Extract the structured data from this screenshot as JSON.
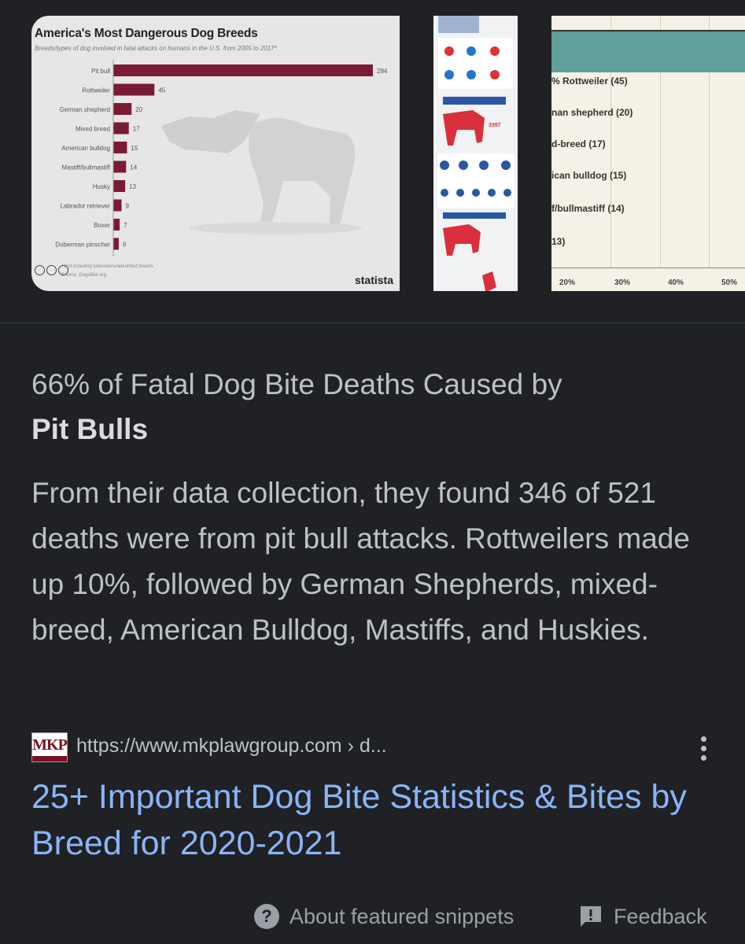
{
  "images": {
    "chart_title": "America's Most Dangerous Dog Breeds",
    "chart_subtitle": "Breeds/types of dog involved in fatal attacks on humans in the U.S. from 2005 to 2017*",
    "chart_footnote": "* Not including unknown/unidentified breeds",
    "chart_source": "Source: DogsBite.org",
    "chart_brand": "statista",
    "infographic_number": "3397",
    "third_rows": [
      "% Rottweiler (45)",
      "nan shepherd (20)",
      "d-breed (17)",
      "ican bulldog (15)",
      "f/bullmastiff (14)",
      "13)"
    ],
    "third_ticks": [
      "20%",
      "30%",
      "40%",
      "50%"
    ]
  },
  "chart_data": {
    "type": "bar",
    "title": "America's Most Dangerous Dog Breeds",
    "subtitle": "Breeds/types of dog involved in fatal attacks on humans in the U.S. from 2005 to 2017*",
    "categories": [
      "Pit bull",
      "Rottweiler",
      "German shepherd",
      "Mixed breed",
      "American bulldog",
      "Mastiff/bullmastiff",
      "Husky",
      "Labrador retriever",
      "Boxer",
      "Doberman pinscher"
    ],
    "values": [
      284,
      45,
      20,
      17,
      15,
      14,
      13,
      9,
      7,
      6
    ],
    "xlim": [
      0,
      300
    ],
    "orientation": "horizontal",
    "bar_color": "#7b1a35"
  },
  "snippet": {
    "headline_plain": "66% of Fatal Dog Bite Deaths Caused by",
    "headline_bold": "Pit Bulls",
    "text": "From their data collection, they found 346 of 521 deaths were from pit bull attacks. Rottweilers made up 10%, followed by German Shepherds, mixed-breed, American Bulldog, Mastiffs, and Huskies."
  },
  "source": {
    "favicon_text": "MKP",
    "url": "https://www.mkplawgroup.com › d...",
    "title": "25+ Important Dog Bite Statistics & Bites by Breed for 2020-2021"
  },
  "footer": {
    "about_icon": "?",
    "about_label": "About featured snippets",
    "feedback_label": "Feedback"
  }
}
